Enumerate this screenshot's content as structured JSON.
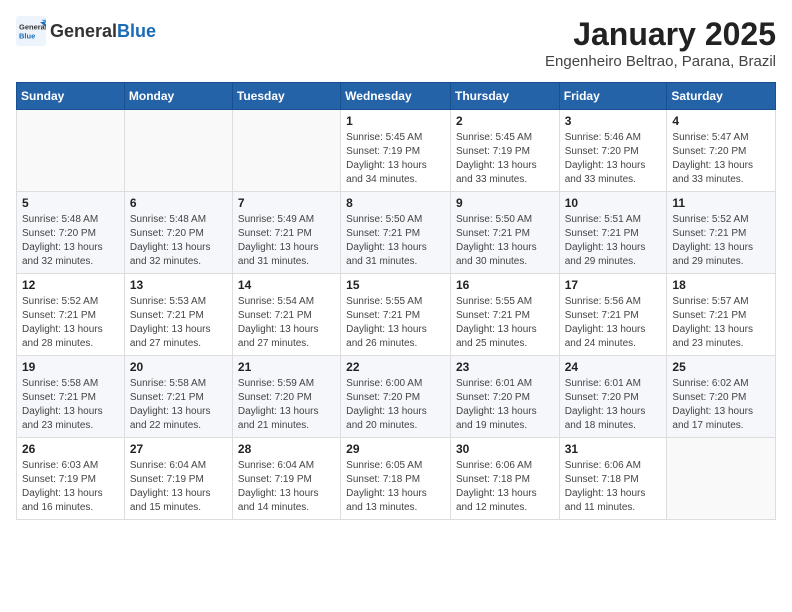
{
  "header": {
    "logo_general": "General",
    "logo_blue": "Blue",
    "title": "January 2025",
    "location": "Engenheiro Beltrao, Parana, Brazil"
  },
  "weekdays": [
    "Sunday",
    "Monday",
    "Tuesday",
    "Wednesday",
    "Thursday",
    "Friday",
    "Saturday"
  ],
  "weeks": [
    [
      {
        "day": "",
        "info": ""
      },
      {
        "day": "",
        "info": ""
      },
      {
        "day": "",
        "info": ""
      },
      {
        "day": "1",
        "info": "Sunrise: 5:45 AM\nSunset: 7:19 PM\nDaylight: 13 hours\nand 34 minutes."
      },
      {
        "day": "2",
        "info": "Sunrise: 5:45 AM\nSunset: 7:19 PM\nDaylight: 13 hours\nand 33 minutes."
      },
      {
        "day": "3",
        "info": "Sunrise: 5:46 AM\nSunset: 7:20 PM\nDaylight: 13 hours\nand 33 minutes."
      },
      {
        "day": "4",
        "info": "Sunrise: 5:47 AM\nSunset: 7:20 PM\nDaylight: 13 hours\nand 33 minutes."
      }
    ],
    [
      {
        "day": "5",
        "info": "Sunrise: 5:48 AM\nSunset: 7:20 PM\nDaylight: 13 hours\nand 32 minutes."
      },
      {
        "day": "6",
        "info": "Sunrise: 5:48 AM\nSunset: 7:20 PM\nDaylight: 13 hours\nand 32 minutes."
      },
      {
        "day": "7",
        "info": "Sunrise: 5:49 AM\nSunset: 7:21 PM\nDaylight: 13 hours\nand 31 minutes."
      },
      {
        "day": "8",
        "info": "Sunrise: 5:50 AM\nSunset: 7:21 PM\nDaylight: 13 hours\nand 31 minutes."
      },
      {
        "day": "9",
        "info": "Sunrise: 5:50 AM\nSunset: 7:21 PM\nDaylight: 13 hours\nand 30 minutes."
      },
      {
        "day": "10",
        "info": "Sunrise: 5:51 AM\nSunset: 7:21 PM\nDaylight: 13 hours\nand 29 minutes."
      },
      {
        "day": "11",
        "info": "Sunrise: 5:52 AM\nSunset: 7:21 PM\nDaylight: 13 hours\nand 29 minutes."
      }
    ],
    [
      {
        "day": "12",
        "info": "Sunrise: 5:52 AM\nSunset: 7:21 PM\nDaylight: 13 hours\nand 28 minutes."
      },
      {
        "day": "13",
        "info": "Sunrise: 5:53 AM\nSunset: 7:21 PM\nDaylight: 13 hours\nand 27 minutes."
      },
      {
        "day": "14",
        "info": "Sunrise: 5:54 AM\nSunset: 7:21 PM\nDaylight: 13 hours\nand 27 minutes."
      },
      {
        "day": "15",
        "info": "Sunrise: 5:55 AM\nSunset: 7:21 PM\nDaylight: 13 hours\nand 26 minutes."
      },
      {
        "day": "16",
        "info": "Sunrise: 5:55 AM\nSunset: 7:21 PM\nDaylight: 13 hours\nand 25 minutes."
      },
      {
        "day": "17",
        "info": "Sunrise: 5:56 AM\nSunset: 7:21 PM\nDaylight: 13 hours\nand 24 minutes."
      },
      {
        "day": "18",
        "info": "Sunrise: 5:57 AM\nSunset: 7:21 PM\nDaylight: 13 hours\nand 23 minutes."
      }
    ],
    [
      {
        "day": "19",
        "info": "Sunrise: 5:58 AM\nSunset: 7:21 PM\nDaylight: 13 hours\nand 23 minutes."
      },
      {
        "day": "20",
        "info": "Sunrise: 5:58 AM\nSunset: 7:21 PM\nDaylight: 13 hours\nand 22 minutes."
      },
      {
        "day": "21",
        "info": "Sunrise: 5:59 AM\nSunset: 7:20 PM\nDaylight: 13 hours\nand 21 minutes."
      },
      {
        "day": "22",
        "info": "Sunrise: 6:00 AM\nSunset: 7:20 PM\nDaylight: 13 hours\nand 20 minutes."
      },
      {
        "day": "23",
        "info": "Sunrise: 6:01 AM\nSunset: 7:20 PM\nDaylight: 13 hours\nand 19 minutes."
      },
      {
        "day": "24",
        "info": "Sunrise: 6:01 AM\nSunset: 7:20 PM\nDaylight: 13 hours\nand 18 minutes."
      },
      {
        "day": "25",
        "info": "Sunrise: 6:02 AM\nSunset: 7:20 PM\nDaylight: 13 hours\nand 17 minutes."
      }
    ],
    [
      {
        "day": "26",
        "info": "Sunrise: 6:03 AM\nSunset: 7:19 PM\nDaylight: 13 hours\nand 16 minutes."
      },
      {
        "day": "27",
        "info": "Sunrise: 6:04 AM\nSunset: 7:19 PM\nDaylight: 13 hours\nand 15 minutes."
      },
      {
        "day": "28",
        "info": "Sunrise: 6:04 AM\nSunset: 7:19 PM\nDaylight: 13 hours\nand 14 minutes."
      },
      {
        "day": "29",
        "info": "Sunrise: 6:05 AM\nSunset: 7:18 PM\nDaylight: 13 hours\nand 13 minutes."
      },
      {
        "day": "30",
        "info": "Sunrise: 6:06 AM\nSunset: 7:18 PM\nDaylight: 13 hours\nand 12 minutes."
      },
      {
        "day": "31",
        "info": "Sunrise: 6:06 AM\nSunset: 7:18 PM\nDaylight: 13 hours\nand 11 minutes."
      },
      {
        "day": "",
        "info": ""
      }
    ]
  ]
}
